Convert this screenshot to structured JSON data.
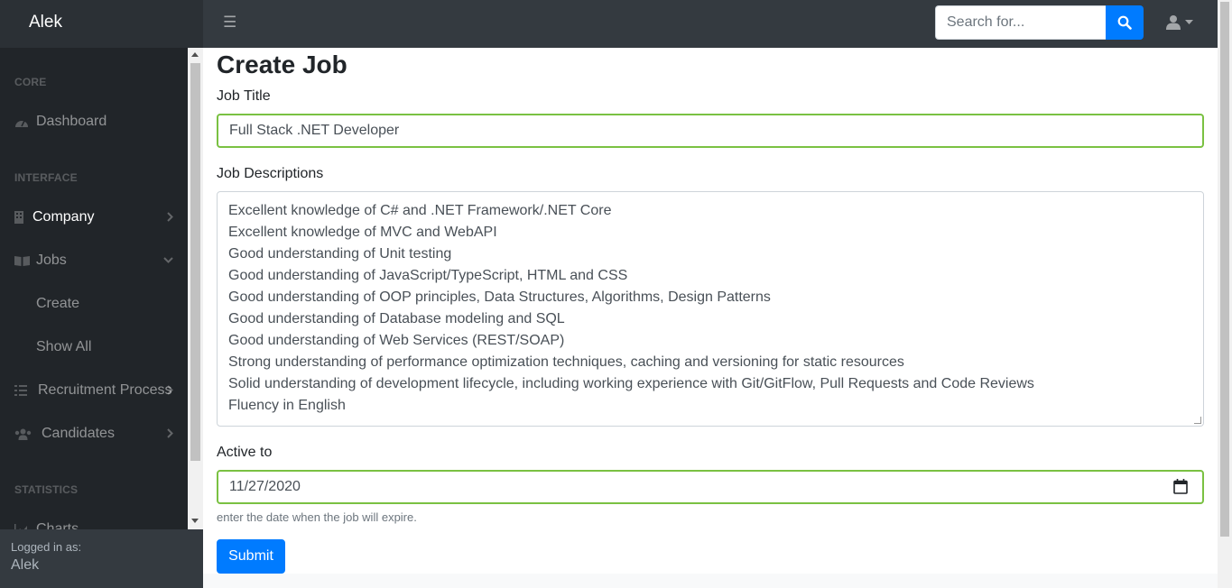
{
  "brand": "Alek",
  "search": {
    "placeholder": "Search for..."
  },
  "sidebar": {
    "headings": [
      "CORE",
      "INTERFACE",
      "STATISTICS"
    ],
    "items": [
      {
        "label": "Dashboard"
      },
      {
        "label": "Company"
      },
      {
        "label": "Jobs"
      },
      {
        "label": "Recruitment Process"
      },
      {
        "label": "Candidates"
      },
      {
        "label": "Charts"
      }
    ],
    "subitems": [
      "Create",
      "Show All"
    ],
    "footer": {
      "logged_in_label": "Logged in as:",
      "user": "Alek"
    }
  },
  "form": {
    "title": "Create Job",
    "job_title_label": "Job Title",
    "job_title_value": "Full Stack .NET Developer",
    "desc_label": "Job Descriptions",
    "desc_lines": [
      "Excellent knowledge of C# and .NET Framework/.NET Core",
      "Excellent knowledge of MVC and WebAPI",
      "Good understanding of Unit testing",
      "Good understanding of JavaScript/TypeScript, HTML and CSS",
      "Good understanding of OOP principles, Data Structures, Algorithms, Design Patterns",
      "Good understanding of Database modeling and SQL",
      "Good understanding of Web Services (REST/SOAP)",
      "Strong understanding of performance optimization techniques, caching and versioning for static resources",
      "Solid understanding of development lifecycle, including working experience with Git/GitFlow, Pull Requests and Code Reviews",
      "Fluency in English"
    ],
    "active_label": "Active to",
    "active_value": "11/27/2020",
    "help": "enter the date when the job will expire.",
    "submit": "Submit"
  }
}
